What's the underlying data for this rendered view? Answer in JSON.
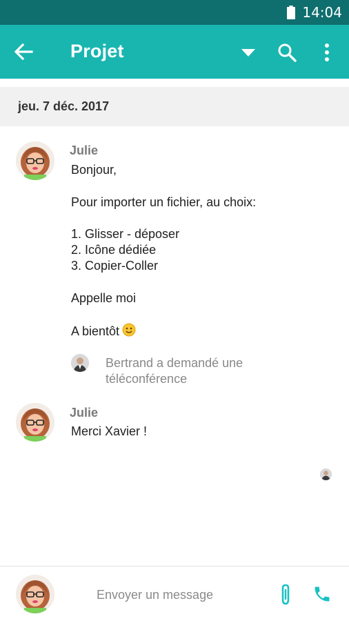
{
  "status_bar": {
    "time": "14:04"
  },
  "app_bar": {
    "title": "Projet"
  },
  "date_header": "jeu. 7 déc. 2017",
  "messages": [
    {
      "sender": "Julie",
      "lines": [
        "Bonjour,",
        "Pour importer un fichier, au choix:",
        "1. Glisser - déposer",
        "2. Icône dédiée",
        "3. Copier-Coller",
        "Appelle moi",
        "A bientôt"
      ],
      "request": "Bertrand a demandé une téléconférence"
    },
    {
      "sender": "Julie",
      "lines": [
        "Merci Xavier !"
      ]
    }
  ],
  "composer": {
    "placeholder": "Envoyer un message"
  },
  "colors": {
    "status_bar": "#0f6e6e",
    "app_bar": "#19b6b0",
    "accent_icons": "#19c1c4",
    "date_header_bg": "#f1f1f1"
  },
  "icons": {
    "back": "back-arrow-icon",
    "dropdown": "dropdown-triangle-icon",
    "search": "search-icon",
    "more": "more-vert-icon",
    "attach": "paperclip-icon",
    "call": "phone-icon",
    "battery": "battery-icon",
    "emoji": "smiling-face-emoji-icon"
  }
}
